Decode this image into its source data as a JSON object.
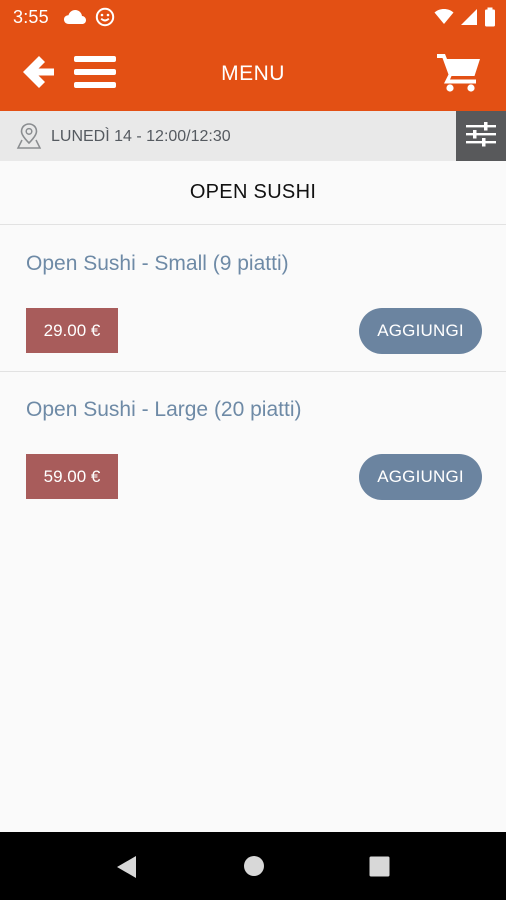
{
  "status_bar": {
    "time": "3:55",
    "left_icons": [
      "cloud-icon",
      "smiley-icon"
    ],
    "right_icons": [
      "wifi-icon",
      "signal-icon",
      "battery-icon"
    ]
  },
  "app_bar": {
    "title": "MENU",
    "back_icon": "arrow-left-icon",
    "menu_icon": "hamburger-icon",
    "cart_icon": "cart-icon",
    "background_color": "#e35014"
  },
  "delivery": {
    "text": "LUNEDÌ 14 - 12:00/12:30",
    "icon": "map-pin-icon",
    "filter_icon": "sliders-icon"
  },
  "category": {
    "title": "OPEN SUSHI"
  },
  "products": [
    {
      "name": "Open Sushi - Small (9 piatti)",
      "price": "29.00 €",
      "add_label": "AGGIUNGI"
    },
    {
      "name": "Open Sushi - Large (20 piatti)",
      "price": "59.00 €",
      "add_label": "AGGIUNGI"
    }
  ],
  "colors": {
    "accent": "#e35014",
    "price_badge": "#a85c5b",
    "add_button": "#6b84a0",
    "product_name": "#6e8aa6"
  },
  "nav_bar": {
    "icons": [
      "nav-back-icon",
      "nav-home-icon",
      "nav-recents-icon"
    ]
  }
}
